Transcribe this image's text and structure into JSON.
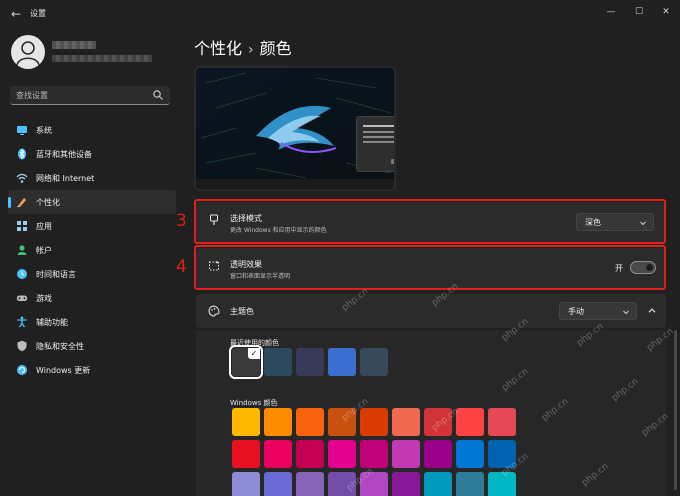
{
  "window": {
    "title": "设置",
    "back_glyph": "←",
    "minimize_glyph": "—",
    "maximize_glyph": "☐",
    "close_glyph": "✕"
  },
  "search": {
    "placeholder": "查找设置"
  },
  "sidebar": {
    "items": [
      {
        "label": "系统",
        "icon": "system-icon",
        "color": "#4cc2ff"
      },
      {
        "label": "蓝牙和其他设备",
        "icon": "bluetooth-icon",
        "color": "#4cc2ff"
      },
      {
        "label": "网络和 Internet",
        "icon": "network-icon",
        "color": "#9cc9e8"
      },
      {
        "label": "个性化",
        "icon": "personalization-icon",
        "color": "#f0a15a",
        "active": true
      },
      {
        "label": "应用",
        "icon": "apps-icon",
        "color": "#9cc9e8"
      },
      {
        "label": "帐户",
        "icon": "accounts-icon",
        "color": "#3ec17a"
      },
      {
        "label": "时间和语言",
        "icon": "time-language-icon",
        "color": "#4cc2ff"
      },
      {
        "label": "游戏",
        "icon": "gaming-icon",
        "color": "#bdbdbd"
      },
      {
        "label": "辅助功能",
        "icon": "accessibility-icon",
        "color": "#4cc2ff"
      },
      {
        "label": "隐私和安全性",
        "icon": "privacy-shield-icon",
        "color": "#bdbdbd"
      },
      {
        "label": "Windows 更新",
        "icon": "windows-update-icon",
        "color": "#4cc2ff"
      }
    ]
  },
  "breadcrumb": {
    "parent": "个性化",
    "separator": "›",
    "current": "颜色"
  },
  "mode": {
    "title": "选择模式",
    "subtitle": "更改 Windows 和应用中显示的颜色",
    "value": "深色",
    "annotation": "3"
  },
  "transparency": {
    "title": "透明效果",
    "subtitle": "窗口和表面显示半透明",
    "state_label": "开",
    "on": true,
    "annotation": "4"
  },
  "accent": {
    "title": "主题色",
    "value": "手动",
    "recent_label": "最近使用的颜色",
    "recent_colors": [
      "#3a3a3a",
      "#2b4a5e",
      "#383a58",
      "#3a6fd0",
      "#36485a"
    ],
    "windows_label": "Windows 颜色",
    "check_glyph": "✓",
    "windows_colors": [
      [
        "#ffb900",
        "#ff8c00",
        "#f7630c",
        "#ca5010",
        "#da3b01",
        "#ef6950",
        "#d13438",
        "#ff4343",
        "#e74856"
      ],
      [
        "#e81123",
        "#ea005e",
        "#c30052",
        "#e3008c",
        "#bf0077",
        "#c239b3",
        "#9a0089",
        "#0078d4",
        "#0063b1"
      ],
      [
        "#8e8cd8",
        "#6b69d6",
        "#8764b8",
        "#744da9",
        "#b146c2",
        "#881798",
        "#0099bc",
        "#2d7d9a",
        "#00b7c3"
      ]
    ]
  },
  "watermark": "php.cn",
  "colors": {
    "highlight": "#e0201b",
    "accent": "#4cc2ff",
    "background": "#202020",
    "card": "#2b2b2b"
  }
}
